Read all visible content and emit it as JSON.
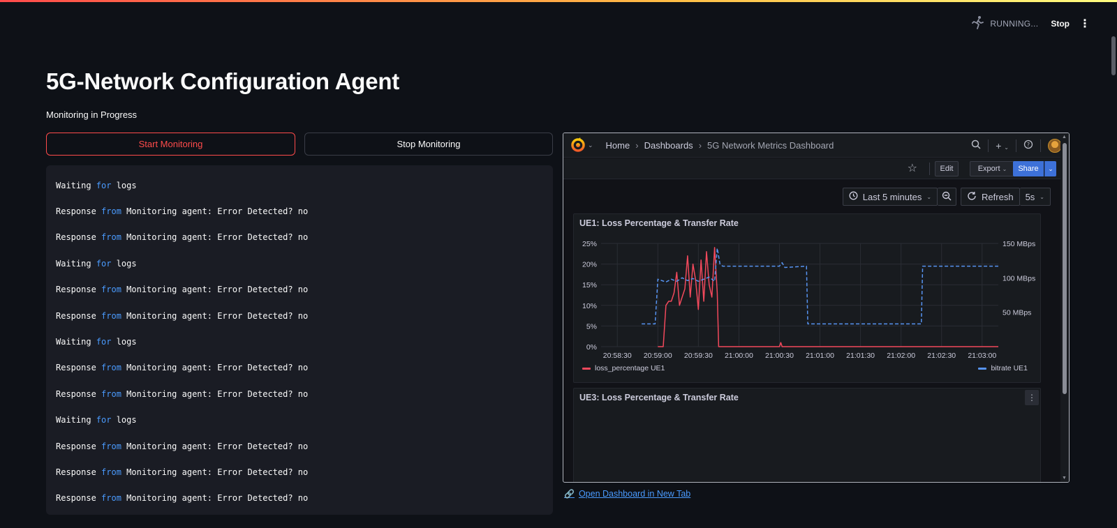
{
  "status": {
    "running_label": "RUNNING...",
    "stop_label": "Stop",
    "menu_icon": "kebab-menu-icon",
    "running_icon": "running-man-icon"
  },
  "header": {
    "title": "5G-Network Configuration Agent",
    "subtitle": "Monitoring in Progress"
  },
  "buttons": {
    "start": "Start Monitoring",
    "stop": "Stop Monitoring"
  },
  "logs": [
    {
      "type": "wait",
      "pre": "Waiting ",
      "kw": "for",
      "post": " logs"
    },
    {
      "type": "resp",
      "pre": "Response ",
      "kw": "from",
      "post": " Monitoring agent: Error Detected? no"
    },
    {
      "type": "resp",
      "pre": "Response ",
      "kw": "from",
      "post": " Monitoring agent: Error Detected? no"
    },
    {
      "type": "wait",
      "pre": "Waiting ",
      "kw": "for",
      "post": " logs"
    },
    {
      "type": "resp",
      "pre": "Response ",
      "kw": "from",
      "post": " Monitoring agent: Error Detected? no"
    },
    {
      "type": "resp",
      "pre": "Response ",
      "kw": "from",
      "post": " Monitoring agent: Error Detected? no"
    },
    {
      "type": "wait",
      "pre": "Waiting ",
      "kw": "for",
      "post": " logs"
    },
    {
      "type": "resp",
      "pre": "Response ",
      "kw": "from",
      "post": " Monitoring agent: Error Detected? no"
    },
    {
      "type": "resp",
      "pre": "Response ",
      "kw": "from",
      "post": " Monitoring agent: Error Detected? no"
    },
    {
      "type": "wait",
      "pre": "Waiting ",
      "kw": "for",
      "post": " logs"
    },
    {
      "type": "resp",
      "pre": "Response ",
      "kw": "from",
      "post": " Monitoring agent: Error Detected? no"
    },
    {
      "type": "resp",
      "pre": "Response ",
      "kw": "from",
      "post": " Monitoring agent: Error Detected? no"
    },
    {
      "type": "resp",
      "pre": "Response ",
      "kw": "from",
      "post": " Monitoring agent: Error Detected? no"
    }
  ],
  "dashboard": {
    "breadcrumb": [
      "Home",
      "Dashboards",
      "5G Network Metrics Dashboard"
    ],
    "actions": {
      "edit": "Edit",
      "export": "Export",
      "share": "Share"
    },
    "time_range": "Last 5 minutes",
    "refresh_label": "Refresh",
    "refresh_interval": "5s",
    "panels": {
      "ue1_title": "UE1: Loss Percentage & Transfer Rate",
      "ue3_title": "UE3: Loss Percentage & Transfer Rate"
    },
    "colors": {
      "loss": "#f2495c",
      "bitrate": "#5794f2"
    }
  },
  "link": {
    "label": "Open Dashboard in New Tab",
    "icon": "link-icon"
  },
  "chart_data": {
    "type": "line",
    "title": "UE1: Loss Percentage & Transfer Rate",
    "x_ticks": [
      "20:58:30",
      "20:59:00",
      "20:59:30",
      "21:00:00",
      "21:00:30",
      "21:01:00",
      "21:01:30",
      "21:02:00",
      "21:02:30",
      "21:03:00"
    ],
    "y_left_ticks": [
      "0%",
      "5%",
      "10%",
      "15%",
      "20%",
      "25%"
    ],
    "y_right_ticks": [
      "50 MBps",
      "100 MBps",
      "150 MBps"
    ],
    "y_left_range": [
      0,
      25
    ],
    "y_right_range": [
      0,
      150
    ],
    "x_range": [
      "20:58:18",
      "21:03:12"
    ],
    "legend_placement": "bottom",
    "series": [
      {
        "name": "loss_percentage UE1",
        "axis": "left",
        "x": [
          "20:59:00",
          "20:59:04",
          "20:59:06",
          "20:59:08",
          "20:59:10",
          "20:59:12",
          "20:59:14",
          "20:59:16",
          "20:59:18",
          "20:59:20",
          "20:59:22",
          "20:59:24",
          "20:59:26",
          "20:59:28",
          "20:59:30",
          "20:59:32",
          "20:59:34",
          "20:59:36",
          "20:59:38",
          "20:59:40",
          "20:59:42",
          "20:59:44",
          "20:59:45",
          "21:00:00",
          "21:00:30",
          "21:00:31",
          "21:00:32",
          "21:01:00",
          "21:02:00",
          "21:03:12"
        ],
        "y": [
          0,
          0,
          10,
          11,
          11,
          13,
          18,
          10,
          12,
          14,
          22,
          12,
          20,
          16,
          9,
          21,
          11,
          23,
          15,
          12,
          24,
          13,
          0,
          0,
          0,
          1,
          0,
          0,
          0,
          0
        ]
      },
      {
        "name": "bitrate UE1",
        "axis": "right",
        "x": [
          "20:58:48",
          "20:58:58",
          "20:59:00",
          "20:59:06",
          "20:59:10",
          "20:59:14",
          "20:59:18",
          "20:59:22",
          "20:59:26",
          "20:59:30",
          "20:59:34",
          "20:59:38",
          "20:59:42",
          "20:59:44",
          "20:59:46",
          "20:59:48",
          "21:00:00",
          "21:00:30",
          "21:00:32",
          "21:00:34",
          "21:00:50",
          "21:00:51",
          "21:02:15",
          "21:02:16",
          "21:02:17",
          "21:02:20",
          "21:02:30",
          "21:02:40",
          "21:03:12"
        ],
        "y": [
          33,
          33,
          98,
          94,
          98,
          95,
          100,
          96,
          99,
          95,
          98,
          101,
          95,
          143,
          120,
          117,
          117,
          117,
          122,
          115,
          117,
          33,
          33,
          117,
          117,
          117,
          117,
          117,
          117
        ]
      }
    ]
  }
}
